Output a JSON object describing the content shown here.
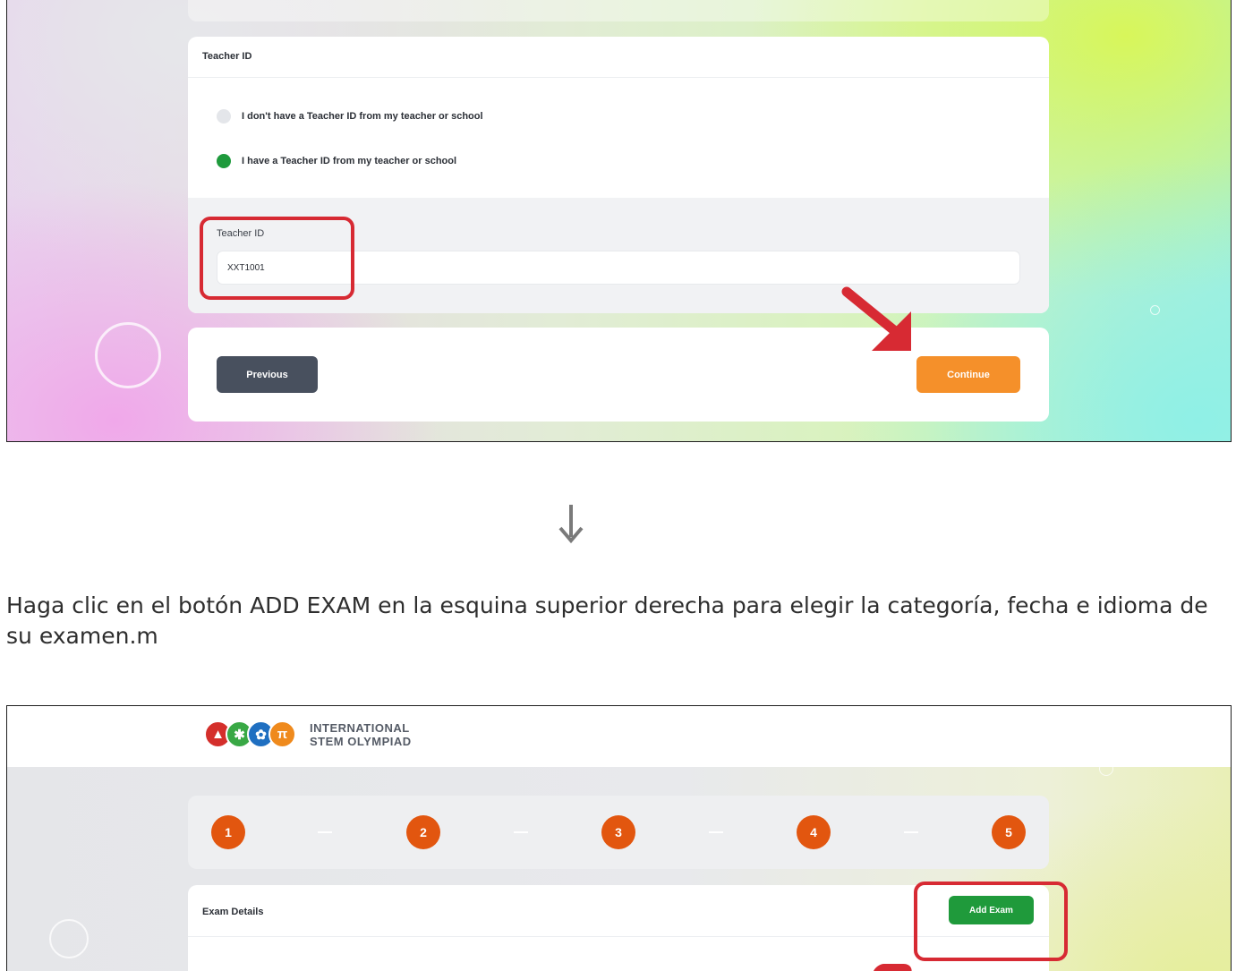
{
  "top_screen": {
    "section_title": "Teacher ID",
    "radio_options": [
      {
        "label": "I don't have a Teacher ID from my teacher or school",
        "selected": false
      },
      {
        "label": "I have a Teacher ID from my teacher or school",
        "selected": true
      }
    ],
    "field_label": "Teacher ID",
    "field_value": "XXT1001",
    "previous_label": "Previous",
    "continue_label": "Continue"
  },
  "instruction": "Haga clic en el botón ADD EXAM en la esquina superior derecha para elegir la categoría, fecha e idioma de su examen.m",
  "bottom_screen": {
    "logo_line1": "INTERNATIONAL",
    "logo_line2": "STEM OLYMPIAD",
    "logo_icons": [
      "flask-icon",
      "chip-icon",
      "gear-icon",
      "pi-icon"
    ],
    "steps": [
      "1",
      "2",
      "3",
      "4",
      "5"
    ],
    "section_title": "Exam Details",
    "add_exam_label": "Add Exam"
  },
  "colors": {
    "step_orange": "#e2560f",
    "highlight_red": "#d72a33",
    "continue_orange": "#f5902a",
    "add_exam_green": "#1f9a3b",
    "radio_selected_green": "#1e9a3c",
    "previous_gray": "#48505e"
  }
}
